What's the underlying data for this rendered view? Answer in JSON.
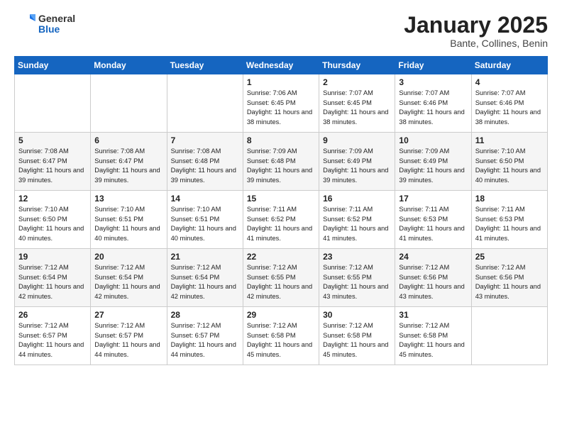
{
  "header": {
    "logo_general": "General",
    "logo_blue": "Blue",
    "title": "January 2025",
    "location": "Bante, Collines, Benin"
  },
  "days_of_week": [
    "Sunday",
    "Monday",
    "Tuesday",
    "Wednesday",
    "Thursday",
    "Friday",
    "Saturday"
  ],
  "weeks": [
    [
      {
        "day": "",
        "info": ""
      },
      {
        "day": "",
        "info": ""
      },
      {
        "day": "",
        "info": ""
      },
      {
        "day": "1",
        "info": "Sunrise: 7:06 AM\nSunset: 6:45 PM\nDaylight: 11 hours and 38 minutes."
      },
      {
        "day": "2",
        "info": "Sunrise: 7:07 AM\nSunset: 6:45 PM\nDaylight: 11 hours and 38 minutes."
      },
      {
        "day": "3",
        "info": "Sunrise: 7:07 AM\nSunset: 6:46 PM\nDaylight: 11 hours and 38 minutes."
      },
      {
        "day": "4",
        "info": "Sunrise: 7:07 AM\nSunset: 6:46 PM\nDaylight: 11 hours and 38 minutes."
      }
    ],
    [
      {
        "day": "5",
        "info": "Sunrise: 7:08 AM\nSunset: 6:47 PM\nDaylight: 11 hours and 39 minutes."
      },
      {
        "day": "6",
        "info": "Sunrise: 7:08 AM\nSunset: 6:47 PM\nDaylight: 11 hours and 39 minutes."
      },
      {
        "day": "7",
        "info": "Sunrise: 7:08 AM\nSunset: 6:48 PM\nDaylight: 11 hours and 39 minutes."
      },
      {
        "day": "8",
        "info": "Sunrise: 7:09 AM\nSunset: 6:48 PM\nDaylight: 11 hours and 39 minutes."
      },
      {
        "day": "9",
        "info": "Sunrise: 7:09 AM\nSunset: 6:49 PM\nDaylight: 11 hours and 39 minutes."
      },
      {
        "day": "10",
        "info": "Sunrise: 7:09 AM\nSunset: 6:49 PM\nDaylight: 11 hours and 39 minutes."
      },
      {
        "day": "11",
        "info": "Sunrise: 7:10 AM\nSunset: 6:50 PM\nDaylight: 11 hours and 40 minutes."
      }
    ],
    [
      {
        "day": "12",
        "info": "Sunrise: 7:10 AM\nSunset: 6:50 PM\nDaylight: 11 hours and 40 minutes."
      },
      {
        "day": "13",
        "info": "Sunrise: 7:10 AM\nSunset: 6:51 PM\nDaylight: 11 hours and 40 minutes."
      },
      {
        "day": "14",
        "info": "Sunrise: 7:10 AM\nSunset: 6:51 PM\nDaylight: 11 hours and 40 minutes."
      },
      {
        "day": "15",
        "info": "Sunrise: 7:11 AM\nSunset: 6:52 PM\nDaylight: 11 hours and 41 minutes."
      },
      {
        "day": "16",
        "info": "Sunrise: 7:11 AM\nSunset: 6:52 PM\nDaylight: 11 hours and 41 minutes."
      },
      {
        "day": "17",
        "info": "Sunrise: 7:11 AM\nSunset: 6:53 PM\nDaylight: 11 hours and 41 minutes."
      },
      {
        "day": "18",
        "info": "Sunrise: 7:11 AM\nSunset: 6:53 PM\nDaylight: 11 hours and 41 minutes."
      }
    ],
    [
      {
        "day": "19",
        "info": "Sunrise: 7:12 AM\nSunset: 6:54 PM\nDaylight: 11 hours and 42 minutes."
      },
      {
        "day": "20",
        "info": "Sunrise: 7:12 AM\nSunset: 6:54 PM\nDaylight: 11 hours and 42 minutes."
      },
      {
        "day": "21",
        "info": "Sunrise: 7:12 AM\nSunset: 6:54 PM\nDaylight: 11 hours and 42 minutes."
      },
      {
        "day": "22",
        "info": "Sunrise: 7:12 AM\nSunset: 6:55 PM\nDaylight: 11 hours and 42 minutes."
      },
      {
        "day": "23",
        "info": "Sunrise: 7:12 AM\nSunset: 6:55 PM\nDaylight: 11 hours and 43 minutes."
      },
      {
        "day": "24",
        "info": "Sunrise: 7:12 AM\nSunset: 6:56 PM\nDaylight: 11 hours and 43 minutes."
      },
      {
        "day": "25",
        "info": "Sunrise: 7:12 AM\nSunset: 6:56 PM\nDaylight: 11 hours and 43 minutes."
      }
    ],
    [
      {
        "day": "26",
        "info": "Sunrise: 7:12 AM\nSunset: 6:57 PM\nDaylight: 11 hours and 44 minutes."
      },
      {
        "day": "27",
        "info": "Sunrise: 7:12 AM\nSunset: 6:57 PM\nDaylight: 11 hours and 44 minutes."
      },
      {
        "day": "28",
        "info": "Sunrise: 7:12 AM\nSunset: 6:57 PM\nDaylight: 11 hours and 44 minutes."
      },
      {
        "day": "29",
        "info": "Sunrise: 7:12 AM\nSunset: 6:58 PM\nDaylight: 11 hours and 45 minutes."
      },
      {
        "day": "30",
        "info": "Sunrise: 7:12 AM\nSunset: 6:58 PM\nDaylight: 11 hours and 45 minutes."
      },
      {
        "day": "31",
        "info": "Sunrise: 7:12 AM\nSunset: 6:58 PM\nDaylight: 11 hours and 45 minutes."
      },
      {
        "day": "",
        "info": ""
      }
    ]
  ]
}
